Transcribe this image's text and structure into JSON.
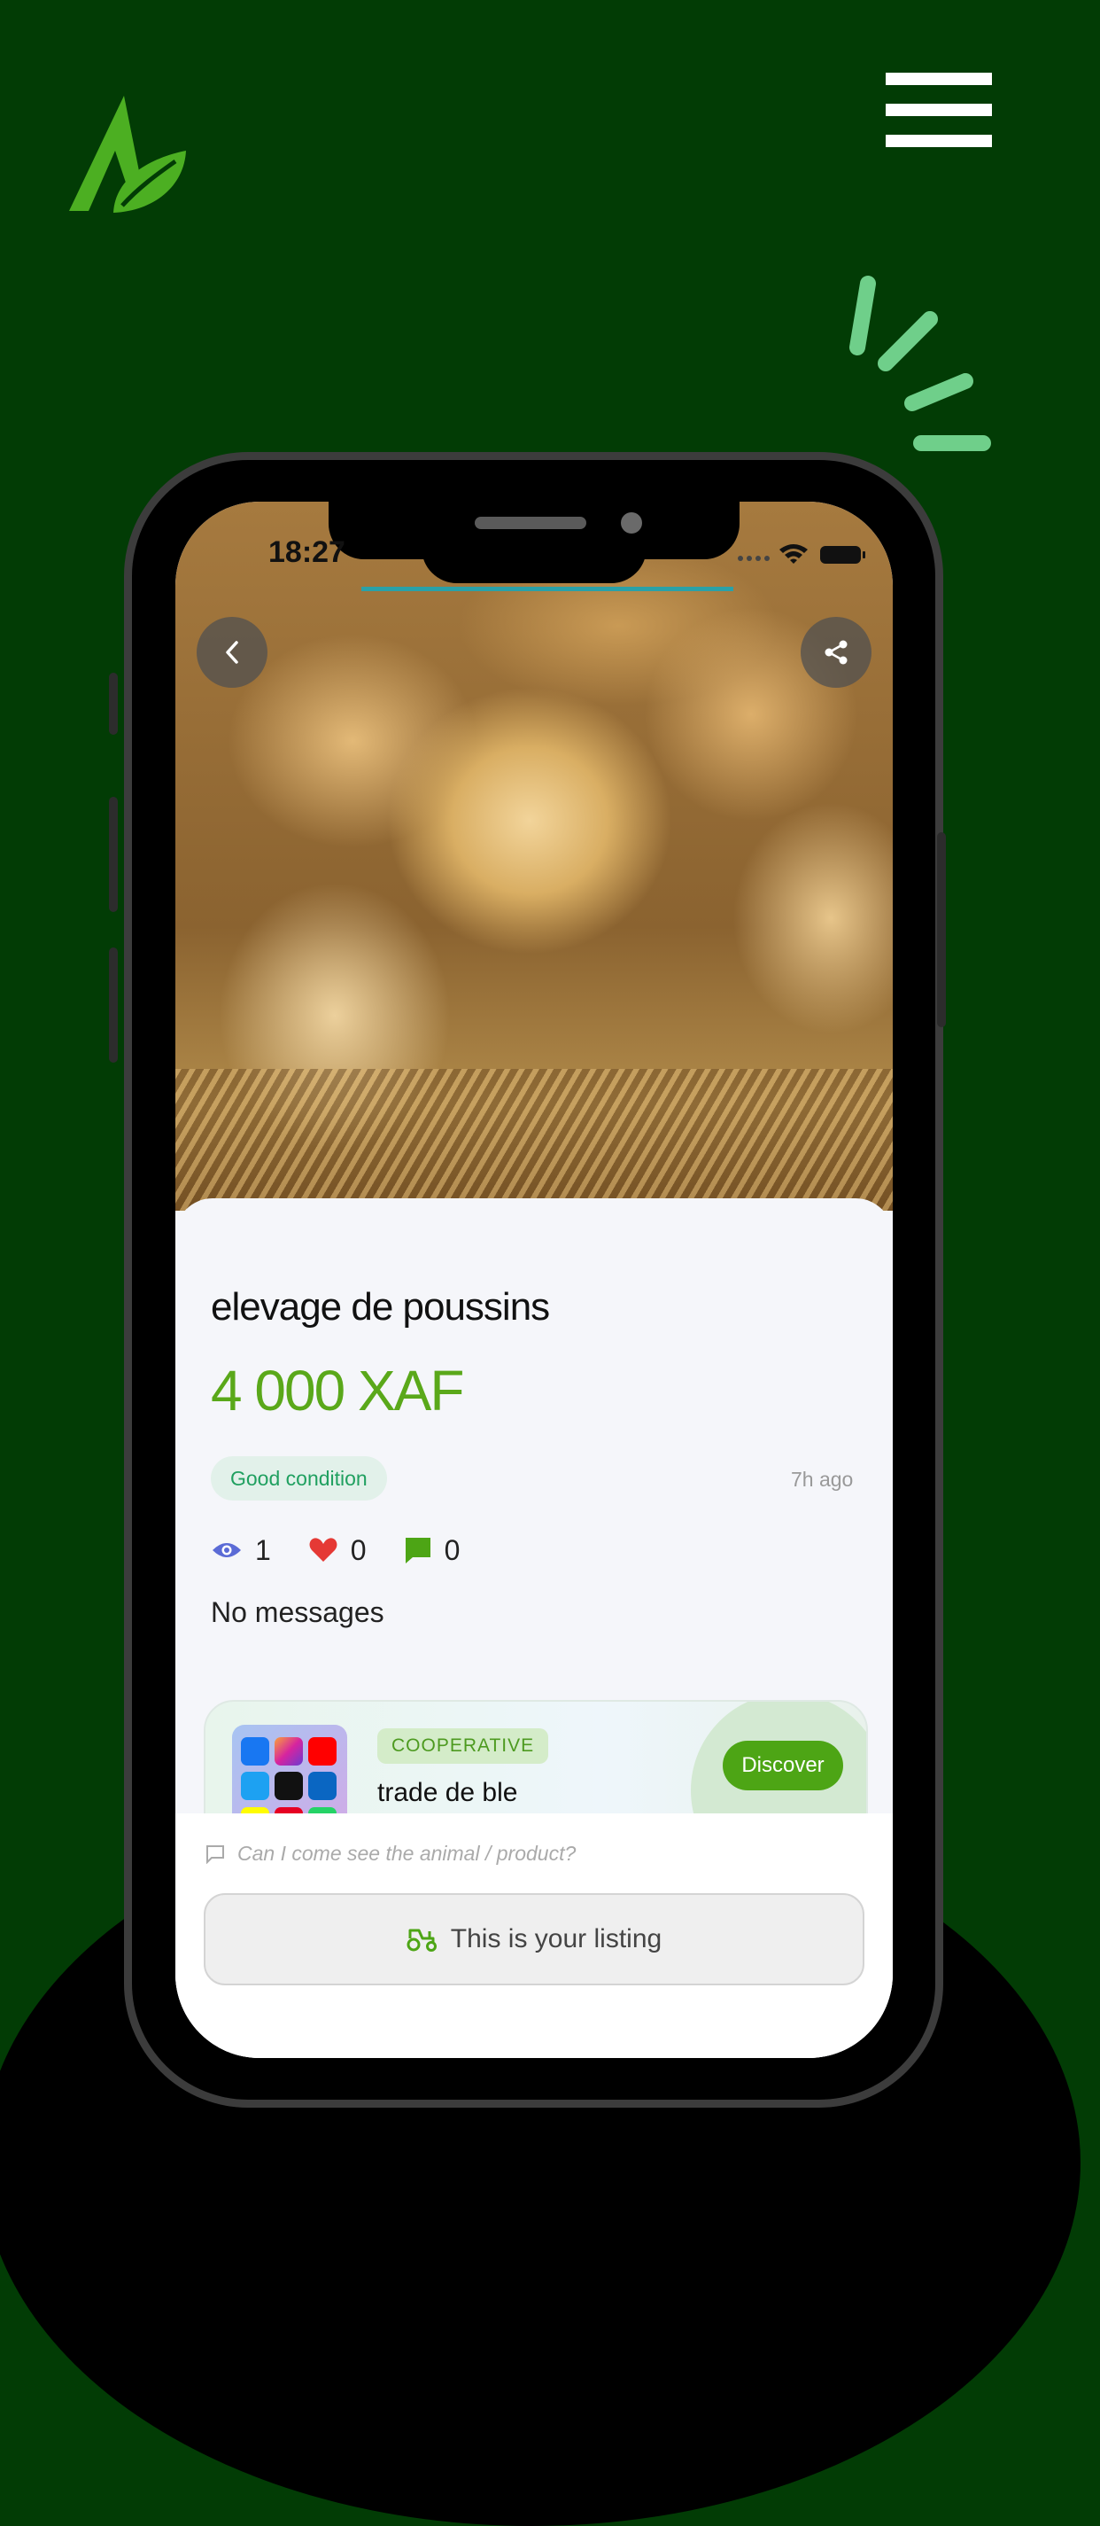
{
  "header": {
    "logo_icon": "leaf-logo-icon",
    "menu_icon": "hamburger-menu-icon"
  },
  "phone": {
    "status_bar": {
      "time": "18:27"
    },
    "back_icon": "chevron-left-icon",
    "share_icon": "share-icon",
    "listing": {
      "title": "elevage de poussins",
      "price": "4 000 XAF",
      "condition": "Good condition",
      "posted": "7h ago",
      "stats": {
        "views": "1",
        "likes": "0",
        "comments": "0"
      },
      "messages_status": "No messages"
    },
    "cooperative": {
      "tag": "COOPERATIVE",
      "name": "trade de ble",
      "button": "Discover"
    },
    "composer": {
      "question": "Can I come see the animal / product?",
      "listing_button": "This is your listing"
    }
  },
  "colors": {
    "background": "#023c05",
    "accent_green": "#5aa81a",
    "badge_text": "#20a060",
    "discover_button": "#4da515"
  }
}
